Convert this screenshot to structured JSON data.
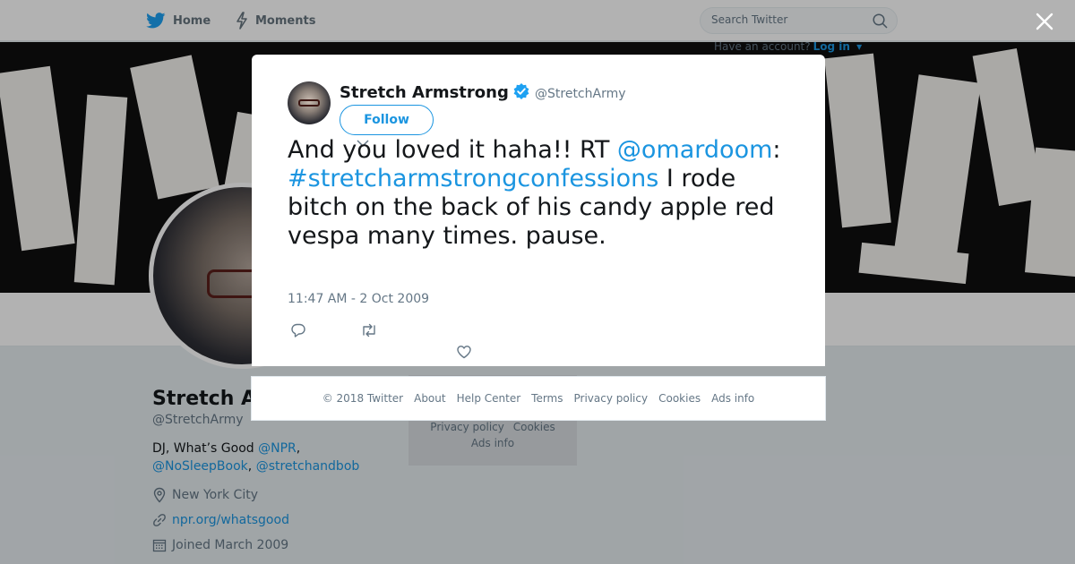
{
  "topnav": {
    "home_label": "Home",
    "moments_label": "Moments",
    "search_placeholder": "Search Twitter",
    "have_account_text": "Have an account?",
    "login_label": "Log in"
  },
  "profile": {
    "name": "Stretch A",
    "handle": "@StretchArmy",
    "bio_text": "DJ, What’s Good",
    "bio_link_npr": "@NPR",
    "bio_link_nosleep": "@NoSleepBook",
    "bio_link_stretchandbob": "@stretchandbob",
    "location": "New York City",
    "url": "npr.org/whatsgood",
    "joined": "Joined March 2009"
  },
  "side_footer": {
    "privacy": "Privacy policy",
    "cookies": "Cookies",
    "ads": "Ads info"
  },
  "tweet": {
    "author_name": "Stretch Armstrong",
    "author_handle": "@StretchArmy",
    "follow_label": "Follow",
    "text_part1": "And you loved it haha!! RT ",
    "mention": "@omardoom",
    "text_part2": ": ",
    "hashtag": "#stretcharmstrongconfessions",
    "text_part3": " I rode bitch on the back of his candy apple red vespa many times. pause.",
    "timestamp": "11:47 AM - 2 Oct 2009"
  },
  "footer": {
    "copyright": "© 2018 Twitter",
    "about": "About",
    "help": "Help Center",
    "terms": "Terms",
    "privacy": "Privacy policy",
    "cookies": "Cookies",
    "ads": "Ads info"
  },
  "colors": {
    "accent": "#1b95e0",
    "verified": "#1da1f2",
    "text_primary": "#14171a",
    "text_secondary": "#657786"
  }
}
